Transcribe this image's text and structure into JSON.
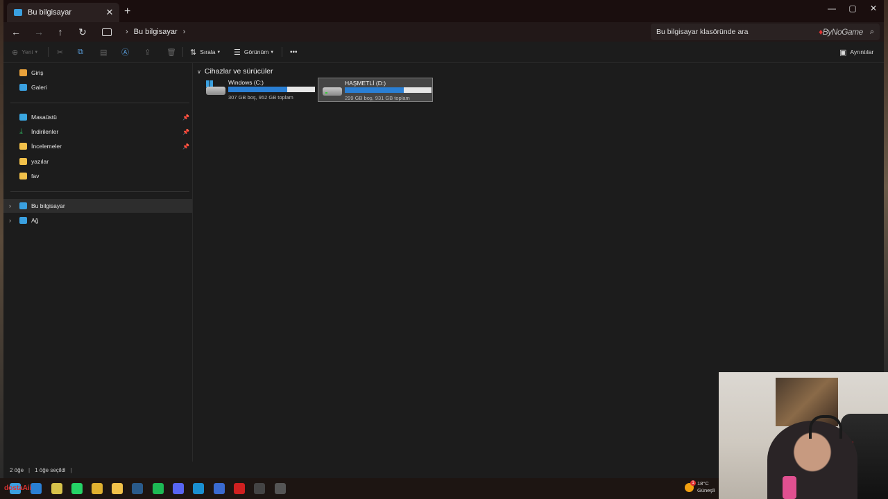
{
  "window": {
    "tab_title": "Bu bilgisayar",
    "new_tab_symbol": "+",
    "close_symbol": "✕",
    "controls": [
      "—",
      "▢",
      "✕"
    ]
  },
  "address": {
    "path": [
      "Bu bilgisayar"
    ],
    "search_placeholder": "Bu bilgisayar klasöründe ara",
    "watermark": "ByNoGame"
  },
  "commands": {
    "new": "Yeni",
    "sort": "Sırala",
    "view": "Görünüm",
    "more": "•••",
    "details": "Ayrıntılar"
  },
  "sidebar": {
    "top": [
      {
        "label": "Giriş",
        "icon": "home-icon",
        "color": "#e9a23b"
      },
      {
        "label": "Galeri",
        "icon": "gallery-icon",
        "color": "#3aa0e0"
      }
    ],
    "pinned": [
      {
        "label": "Masaüstü",
        "icon": "desktop-folder-icon",
        "color": "#3aa6e0",
        "pinned": true
      },
      {
        "label": "İndirilenler",
        "icon": "download-icon",
        "color": "#2fa85a",
        "pinned": true
      },
      {
        "label": "İncelemeler",
        "icon": "folder-icon",
        "color": "#f2c14a",
        "pinned": true
      },
      {
        "label": "yazılar",
        "icon": "folder-icon",
        "color": "#f2c14a",
        "pinned": false
      },
      {
        "label": "fav",
        "icon": "folder-icon",
        "color": "#f2c14a",
        "pinned": false
      }
    ],
    "locations": [
      {
        "label": "Bu bilgisayar",
        "icon": "computer-icon",
        "color": "#3aa0e0",
        "selected": true
      },
      {
        "label": "Ağ",
        "icon": "network-icon",
        "color": "#3aa0e0",
        "selected": false
      }
    ]
  },
  "content": {
    "group_title": "Cihazlar ve sürücüler",
    "drives": [
      {
        "name": "Windows (C:)",
        "info": "307 GB boş, 952 GB toplam",
        "used_fraction": 0.677,
        "selected": false
      },
      {
        "name": "HAŞMETLİ (D:)",
        "info": "299 GB boş, 931 GB toplam",
        "used_fraction": 0.679,
        "selected": true
      }
    ]
  },
  "status": {
    "item_count": "2 öğe",
    "selected": "1 öğe seçildi"
  },
  "taskbar": {
    "label": "dostaAii",
    "weather_temp": "18°C",
    "weather_desc": "Güneşli",
    "notification_count": "1",
    "apps": [
      {
        "name": "start-icon",
        "color": "#3aa0e0"
      },
      {
        "name": "app-icon",
        "color": "#2a7fd4"
      },
      {
        "name": "terminal-icon",
        "color": "#d8c24a"
      },
      {
        "name": "whatsapp-icon",
        "color": "#25d366"
      },
      {
        "name": "chrome-icon",
        "color": "#e0b030"
      },
      {
        "name": "file-explorer-icon",
        "color": "#f2c14a"
      },
      {
        "name": "steam-icon",
        "color": "#2a5a8a"
      },
      {
        "name": "spotify-icon",
        "color": "#1db954"
      },
      {
        "name": "discord-icon",
        "color": "#5865f2"
      },
      {
        "name": "photos-icon",
        "color": "#1a8fd0"
      },
      {
        "name": "messenger-icon",
        "color": "#3a6ad0"
      },
      {
        "name": "acrobat-icon",
        "color": "#d02020"
      },
      {
        "name": "console-icon",
        "color": "#444444"
      },
      {
        "name": "obs-icon",
        "color": "#555555"
      }
    ]
  }
}
